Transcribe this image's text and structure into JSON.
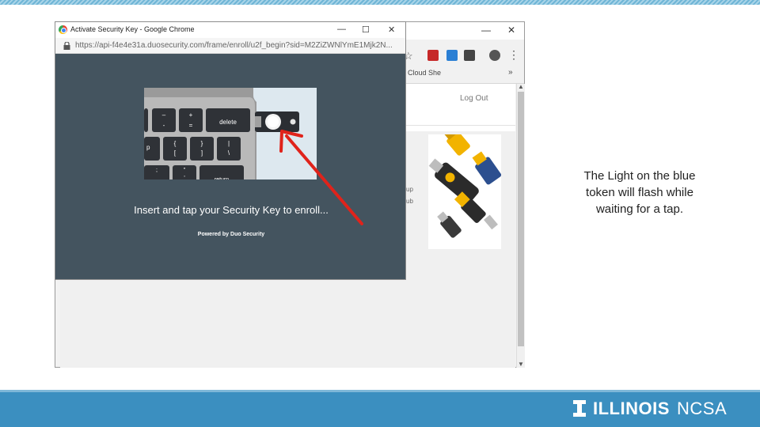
{
  "bg_browser": {
    "bookmark": "Cloud She",
    "bookmark_more": "»",
    "logout": "Log Out",
    "side_text_1": "up",
    "side_text_2": "ub",
    "menu_icon": "kebab-menu-icon",
    "star_icon": "bookmark-star-icon"
  },
  "popup": {
    "title": "Activate Security Key - Google Chrome",
    "url": "https://api-f4e4e31a.duosecurity.com/frame/enroll/u2f_begin?sid=M2ZiZWNlYmE1Mjk2N...",
    "insert_text": "Insert and tap your Security Key to enroll...",
    "powered_by": "Powered by Duo Security",
    "minimize": "—",
    "maximize": "☐",
    "close": "✕"
  },
  "illustration": {
    "key_minus_top": "–",
    "key_minus_bottom": "-",
    "key_plus_top": "+",
    "key_plus_bottom": "=",
    "key_delete": "delete",
    "key_p": "p",
    "key_brace_top": "{",
    "key_brace_bottom": "[",
    "key_rbrace_top": "}",
    "key_rbrace_bottom": "]",
    "key_pipe_top": "|",
    "key_pipe_bottom": "\\",
    "key_return": "return",
    "key_quote_top": "\"",
    "key_quote_bottom": "'",
    "key_semi": ";"
  },
  "caption": {
    "line1": "The Light on the blue",
    "line2": "token will flash while",
    "line3": "waiting for a tap."
  },
  "footer": {
    "brand": "ILLINOIS",
    "org": "NCSA"
  },
  "colors": {
    "popup_bg": "#44545f",
    "arrow_red": "#e0231b",
    "footer_blue": "#3b8fc0",
    "key_yellow": "#f2b300"
  }
}
